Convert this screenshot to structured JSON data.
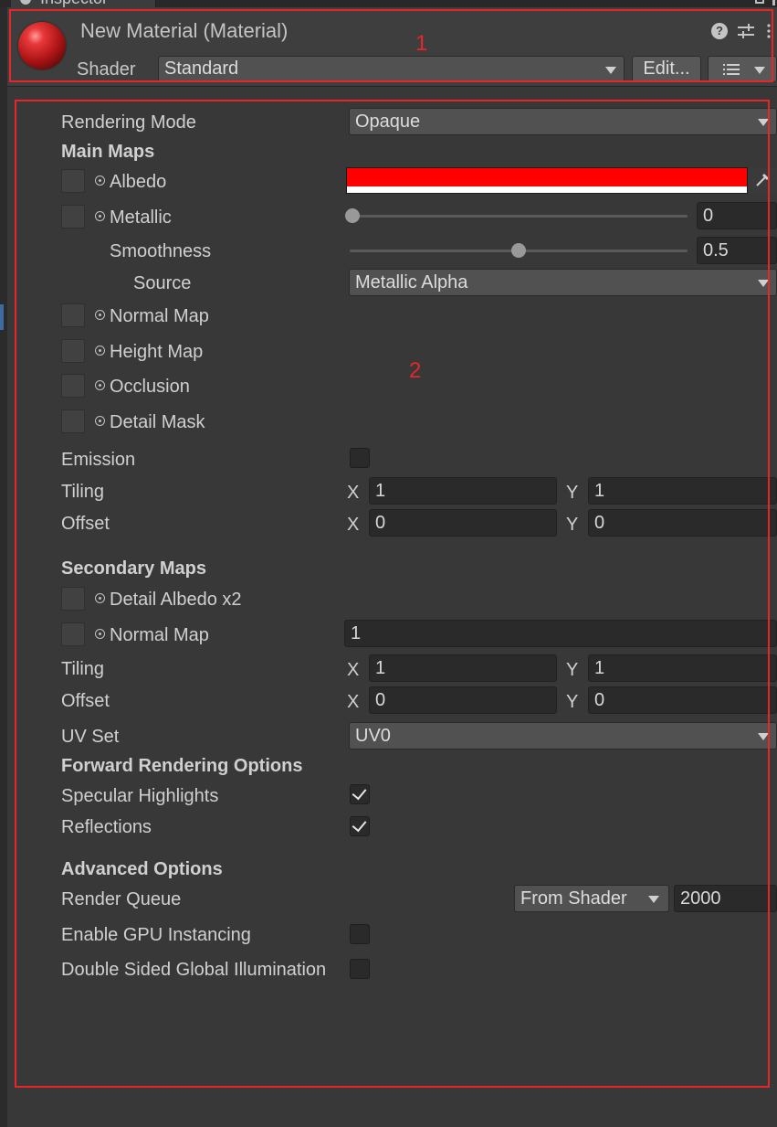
{
  "tab": {
    "label": "Inspector"
  },
  "header": {
    "title": "New Material (Material)",
    "help_icon": "question-mark-icon",
    "settings_icon": "sliders-icon",
    "more_icon": "vertical-ellipsis-icon",
    "shader_label": "Shader",
    "shader_value": "Standard",
    "edit_label": "Edit...",
    "list_icon": "list-icon"
  },
  "annotations": {
    "box1": "1",
    "box2": "2"
  },
  "colors": {
    "albedo": "#ff0000",
    "annotation": "#e8262a",
    "background": "#383838"
  },
  "main": {
    "rendering_mode_label": "Rendering Mode",
    "rendering_mode_value": "Opaque",
    "main_maps_heading": "Main Maps",
    "albedo_label": "Albedo",
    "metallic_label": "Metallic",
    "metallic_value": "0",
    "smoothness_label": "Smoothness",
    "smoothness_value": "0.5",
    "source_label": "Source",
    "source_value": "Metallic Alpha",
    "normal_map_label": "Normal Map",
    "height_map_label": "Height Map",
    "occlusion_label": "Occlusion",
    "detail_mask_label": "Detail Mask",
    "emission_label": "Emission",
    "tiling_label": "Tiling",
    "offset_label": "Offset",
    "tiling": {
      "x": "1",
      "y": "1"
    },
    "offset": {
      "x": "0",
      "y": "0"
    },
    "axis_x": "X",
    "axis_y": "Y"
  },
  "secondary": {
    "heading": "Secondary Maps",
    "detail_albedo_label": "Detail Albedo x2",
    "normal_map_label": "Normal Map",
    "normal_map_value": "1",
    "tiling_label": "Tiling",
    "offset_label": "Offset",
    "tiling": {
      "x": "1",
      "y": "1"
    },
    "offset": {
      "x": "0",
      "y": "0"
    },
    "uv_set_label": "UV Set",
    "uv_set_value": "UV0"
  },
  "forward": {
    "heading": "Forward Rendering Options",
    "specular_label": "Specular Highlights",
    "specular_checked": true,
    "reflections_label": "Reflections",
    "reflections_checked": true
  },
  "advanced": {
    "heading": "Advanced Options",
    "render_queue_label": "Render Queue",
    "render_queue_mode": "From Shader",
    "render_queue_value": "2000",
    "gpu_instancing_label": "Enable GPU Instancing",
    "gpu_instancing_checked": false,
    "double_sided_label": "Double Sided Global Illumination",
    "double_sided_checked": false
  }
}
